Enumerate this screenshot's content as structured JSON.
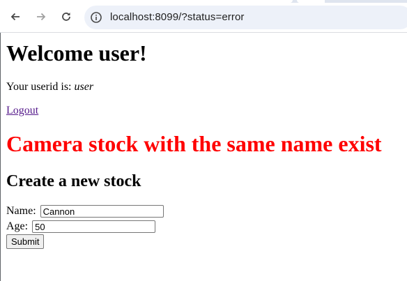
{
  "browser": {
    "url": "localhost:8099/?status=error"
  },
  "page": {
    "welcome_heading": "Welcome user!",
    "userid_label": "Your userid is: ",
    "userid_value": "user",
    "logout_link": "Logout",
    "error_message": "Camera stock with the same name exist",
    "form_heading": "Create a new stock",
    "form": {
      "name_label": "Name:",
      "name_value": "Cannon",
      "age_label": "Age:",
      "age_value": "50",
      "submit_label": "Submit"
    }
  },
  "colors": {
    "error": "#ff0000",
    "link_visited": "#551a8b",
    "omnibox_bg": "#edf1f9"
  },
  "icons": [
    "back-arrow-icon",
    "forward-arrow-icon",
    "reload-icon",
    "site-info-icon"
  ]
}
